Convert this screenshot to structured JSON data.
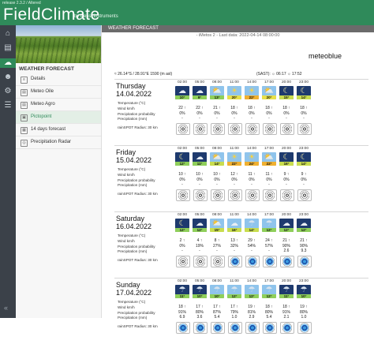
{
  "header": {
    "version": "release 2.3.2 / Altered",
    "logo": "FieldClimate",
    "by": "by Pessl Instruments"
  },
  "rail": {
    "icons": [
      "home-icon",
      "chart-icon",
      "grid-icon",
      "weather-icon",
      "user-icon",
      "gear-icon",
      "settings-icon"
    ],
    "collapse": "«"
  },
  "sidebar": {
    "title": "WEATHER FORECAST",
    "items": [
      {
        "label": "Details",
        "icon": "list-icon"
      },
      {
        "label": "Meteo Oile",
        "icon": "doc-icon"
      },
      {
        "label": "Meteo Agro",
        "icon": "doc-icon"
      },
      {
        "label": "Pictopoint",
        "icon": "picture-icon",
        "active": true
      },
      {
        "label": "14 days forecast",
        "icon": "calendar-icon"
      },
      {
        "label": "Precipitation Radar",
        "icon": "radar-icon"
      }
    ]
  },
  "main": {
    "strip_title": "WEATHER FORECAST",
    "status": "- iMetos 2 - Last data: 2022-04-14 08:00:00",
    "brand": "meteoblue",
    "coords": "≈ 26.14°S / 28.91°E 1590 (m asl)",
    "sun": "(SAST): ☼ 06:17 ☼ 17:52",
    "labels": {
      "temperature": "Temperature (°C)",
      "wind": "Wind km/h",
      "prob": "Precipitation probability",
      "precip": "Precipitation (mm)",
      "radius": "rainSPOT Radius: 30 km"
    },
    "hours": [
      "02:00",
      "05:00",
      "08:00",
      "11:00",
      "14:00",
      "17:00",
      "20:00",
      "23:00"
    ]
  },
  "days": [
    {
      "name": "Thursday",
      "date": "14.04.2022",
      "icons": [
        "moon-cloud",
        "moon-cloud",
        "sun-cloud",
        "sun",
        "sun",
        "sun-cloud",
        "moon",
        "moon"
      ],
      "night": [
        true,
        true,
        false,
        false,
        false,
        false,
        true,
        true
      ],
      "temps": [
        "10°",
        "9°",
        "13°",
        "20°",
        "22°",
        "20°",
        "15°",
        "14°"
      ],
      "wind": [
        "22",
        "22",
        "21",
        "18",
        "18",
        "18",
        "18",
        "18"
      ],
      "prob": [
        "0%",
        "0%",
        "0%",
        "0%",
        "0%",
        "0%",
        "0%",
        "0%"
      ],
      "precip": [
        "-",
        "-",
        "-",
        "-",
        "-",
        "-",
        "-",
        "-"
      ],
      "wet": [
        false,
        false,
        false,
        false,
        false,
        false,
        false,
        false
      ]
    },
    {
      "name": "Friday",
      "date": "15.04.2022",
      "icons": [
        "moon",
        "moon-cloud",
        "sun-cloud",
        "sun",
        "sun",
        "sun-cloud",
        "moon",
        "moon"
      ],
      "night": [
        true,
        true,
        false,
        false,
        false,
        false,
        true,
        true
      ],
      "temps": [
        "12°",
        "11°",
        "14°",
        "22°",
        "24°",
        "22°",
        "16°",
        "14°"
      ],
      "wind": [
        "10",
        "10",
        "10",
        "12",
        "11",
        "11",
        "9",
        "9"
      ],
      "prob": [
        "0%",
        "0%",
        "0%",
        "0%",
        "0%",
        "0%",
        "0%",
        "0%"
      ],
      "precip": [
        "-",
        "-",
        "-",
        "-",
        "-",
        "-",
        "-",
        "-"
      ],
      "wet": [
        false,
        false,
        false,
        false,
        false,
        false,
        false,
        false
      ]
    },
    {
      "name": "Saturday",
      "date": "16.04.2022",
      "icons": [
        "moon",
        "moon-cloud",
        "sun-cloud",
        "cloud",
        "rain",
        "rain",
        "cloud",
        "cloud"
      ],
      "night": [
        true,
        true,
        false,
        false,
        false,
        false,
        true,
        true
      ],
      "temps": [
        "12°",
        "12°",
        "15°",
        "16°",
        "14°",
        "12°",
        "12°",
        "12°"
      ],
      "wind": [
        "2",
        "4",
        "8",
        "13",
        "29",
        "24",
        "21",
        "21"
      ],
      "prob": [
        "0%",
        "19%",
        "27%",
        "32%",
        "54%",
        "57%",
        "90%",
        "90%"
      ],
      "precip": [
        "-",
        "-",
        "-",
        "-",
        "-",
        "-",
        "2.6",
        "9.3"
      ],
      "wet": [
        false,
        false,
        false,
        true,
        true,
        true,
        true,
        true
      ]
    },
    {
      "name": "Sunday",
      "date": "17.04.2022",
      "icons": [
        "rain",
        "rain",
        "rain",
        "rain",
        "rain",
        "rain",
        "rain",
        "rain"
      ],
      "night": [
        true,
        true,
        false,
        false,
        false,
        false,
        true,
        true
      ],
      "temps": [
        "11°",
        "10°",
        "10°",
        "12°",
        "12°",
        "12°",
        "11°",
        "10°"
      ],
      "wind": [
        "18",
        "17",
        "17",
        "17",
        "19",
        "18",
        "18",
        "19"
      ],
      "prob": [
        "91%",
        "80%",
        "87%",
        "79%",
        "81%",
        "80%",
        "91%",
        "80%"
      ],
      "precip": [
        "6.9",
        "3.6",
        "5.4",
        "1.0",
        "2.9",
        "5.4",
        "2.1",
        "1.0"
      ],
      "wet": [
        true,
        true,
        true,
        true,
        true,
        true,
        true,
        true
      ]
    }
  ]
}
